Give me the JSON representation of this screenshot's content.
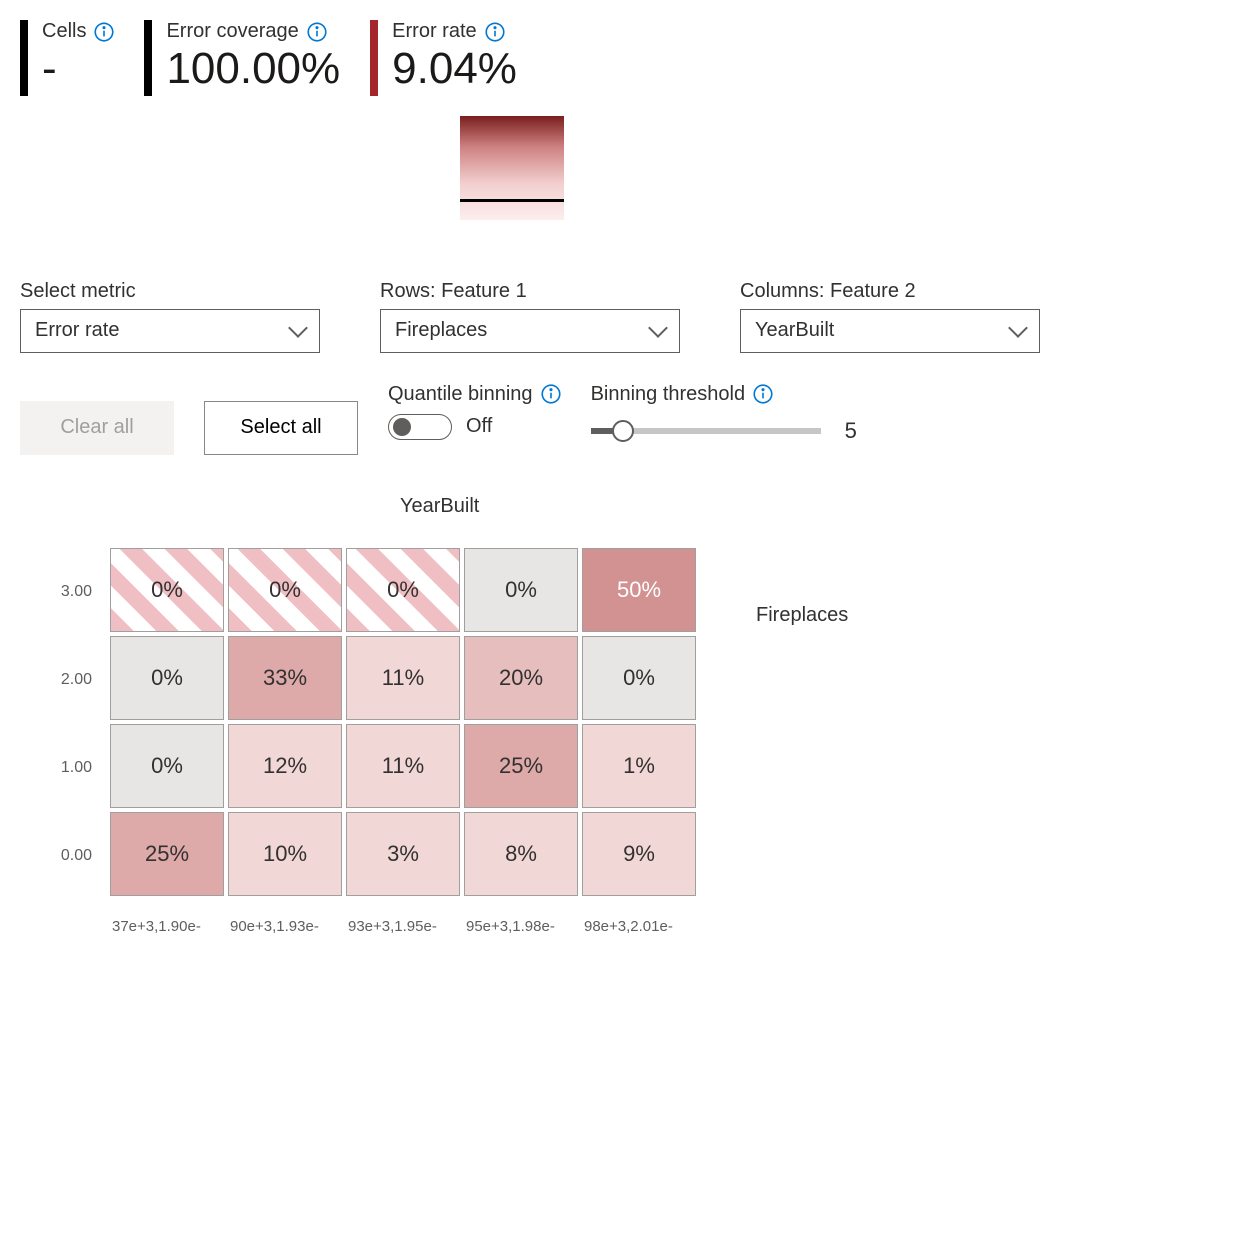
{
  "metrics": {
    "cells": {
      "label": "Cells",
      "value": "-"
    },
    "coverage": {
      "label": "Error coverage",
      "value": "100.00%"
    },
    "rate": {
      "label": "Error rate",
      "value": "9.04%"
    }
  },
  "selectors": {
    "metric": {
      "label": "Select metric",
      "value": "Error rate"
    },
    "rows": {
      "label": "Rows: Feature 1",
      "value": "Fireplaces"
    },
    "cols": {
      "label": "Columns: Feature 2",
      "value": "YearBuilt"
    }
  },
  "buttons": {
    "clear": "Clear all",
    "select": "Select all"
  },
  "quantile": {
    "label": "Quantile binning",
    "state": "Off"
  },
  "binning": {
    "label": "Binning threshold",
    "value": "5"
  },
  "heatmap": {
    "col_title": "YearBuilt",
    "row_title": "Fireplaces",
    "y_labels": [
      "3.00",
      "2.00",
      "1.00",
      "0.00"
    ],
    "x_labels": [
      "37e+3,1.90e-",
      "90e+3,1.93e-",
      "93e+3,1.95e-",
      "95e+3,1.98e-",
      "98e+3,2.01e-"
    ],
    "cells": [
      [
        {
          "v": "0%",
          "s": "hatch"
        },
        {
          "v": "0%",
          "s": "hatch"
        },
        {
          "v": "0%",
          "s": "hatch"
        },
        {
          "v": "0%",
          "s": "shade0"
        },
        {
          "v": "50%",
          "s": "shade4"
        }
      ],
      [
        {
          "v": "0%",
          "s": "shade0"
        },
        {
          "v": "33%",
          "s": "shade3"
        },
        {
          "v": "11%",
          "s": "shade1"
        },
        {
          "v": "20%",
          "s": "shade2"
        },
        {
          "v": "0%",
          "s": "shade0"
        }
      ],
      [
        {
          "v": "0%",
          "s": "shade0"
        },
        {
          "v": "12%",
          "s": "shade1"
        },
        {
          "v": "11%",
          "s": "shade1"
        },
        {
          "v": "25%",
          "s": "shade3"
        },
        {
          "v": "1%",
          "s": "shade1"
        }
      ],
      [
        {
          "v": "25%",
          "s": "shade3"
        },
        {
          "v": "10%",
          "s": "shade1"
        },
        {
          "v": "3%",
          "s": "shade1"
        },
        {
          "v": "8%",
          "s": "shade1"
        },
        {
          "v": "9%",
          "s": "shade1"
        }
      ]
    ]
  },
  "chart_data": {
    "type": "heatmap",
    "title": "Error rate heatmap",
    "xlabel": "YearBuilt",
    "ylabel": "Fireplaces",
    "y_categories": [
      "3.00",
      "2.00",
      "1.00",
      "0.00"
    ],
    "x_categories": [
      "37e+3,1.90e-",
      "90e+3,1.93e-",
      "93e+3,1.95e-",
      "95e+3,1.98e-",
      "98e+3,2.01e-"
    ],
    "values": [
      [
        0,
        0,
        0,
        0,
        50
      ],
      [
        0,
        33,
        11,
        20,
        0
      ],
      [
        0,
        12,
        11,
        25,
        1
      ],
      [
        25,
        10,
        3,
        8,
        9
      ]
    ],
    "value_unit": "%",
    "empty_cells": [
      [
        0,
        0
      ],
      [
        0,
        1
      ],
      [
        0,
        2
      ]
    ]
  }
}
